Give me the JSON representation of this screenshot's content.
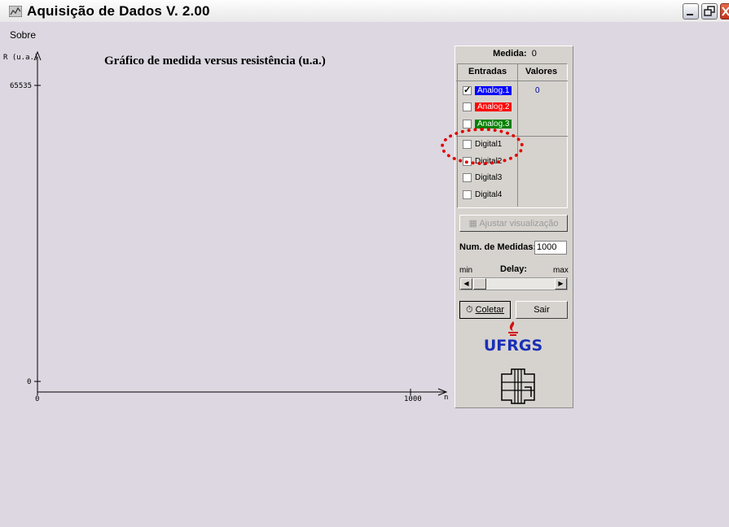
{
  "window": {
    "title": "Aquisição de Dados V. 2.00"
  },
  "menu": {
    "items": [
      "Sobre"
    ]
  },
  "chart_data": {
    "type": "line",
    "title": "Gráfico de medida versus resistência (u.a.)",
    "ylabel": "R (u.a.)",
    "xlabel": "n",
    "yticks": [
      "65535",
      "0"
    ],
    "xticks": [
      "0",
      "1000"
    ],
    "ylim": [
      0,
      65535
    ],
    "xlim": [
      0,
      1000
    ],
    "series": []
  },
  "panel": {
    "medida_label": "Medida:",
    "medida_value": "0",
    "entradas_header": "Entradas",
    "valores_header": "Valores",
    "analog_value": "0",
    "inputs": [
      {
        "label": "Analog.1",
        "checked": true
      },
      {
        "label": "Analog.2",
        "checked": false
      },
      {
        "label": "Analog.3",
        "checked": false
      },
      {
        "label": "Digital1",
        "checked": false
      },
      {
        "label": "Digital2",
        "checked": false
      },
      {
        "label": "Digital3",
        "checked": false
      },
      {
        "label": "Digital4",
        "checked": false
      }
    ],
    "adjust_button": "Ajustar visualização",
    "num_medidas_label": "Num. de Medidas:",
    "num_medidas_value": "1000",
    "delay_label": "Delay:",
    "delay_min": "min",
    "delay_max": "max",
    "coletar_button": "Coletar",
    "sair_button": "Sair",
    "logo_text": "UFRGS"
  },
  "colors": {
    "analog1": "#0000ff",
    "analog2": "#ff0000",
    "analog3": "#008000",
    "logo": "#1a2fb8",
    "highlight": "#e00000"
  }
}
